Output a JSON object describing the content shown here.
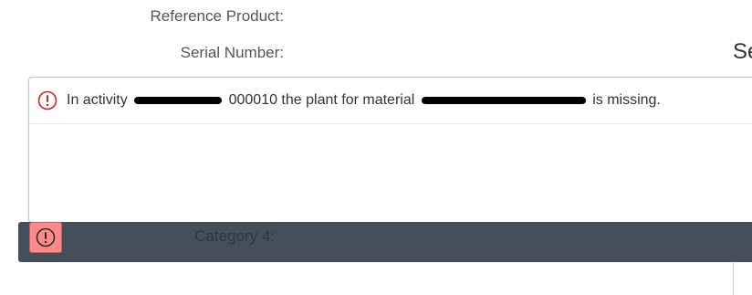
{
  "form": {
    "reference_product_label": "Reference Product:",
    "serial_number_label": "Serial Number:",
    "serial_number_value_partial": "Se",
    "category4_label": "Category 4:"
  },
  "message": {
    "text_before": "In activity",
    "text_middle": "000010 the plant for material",
    "text_after": "is missing.",
    "severity": "error",
    "icon": "error-circle-icon"
  },
  "message_bar": {
    "button_icon": "error-circle-icon"
  },
  "colors": {
    "error_red": "#e01b1b",
    "error_button_bg": "#ff8a8a",
    "message_bar_bg": "#454f5a"
  }
}
